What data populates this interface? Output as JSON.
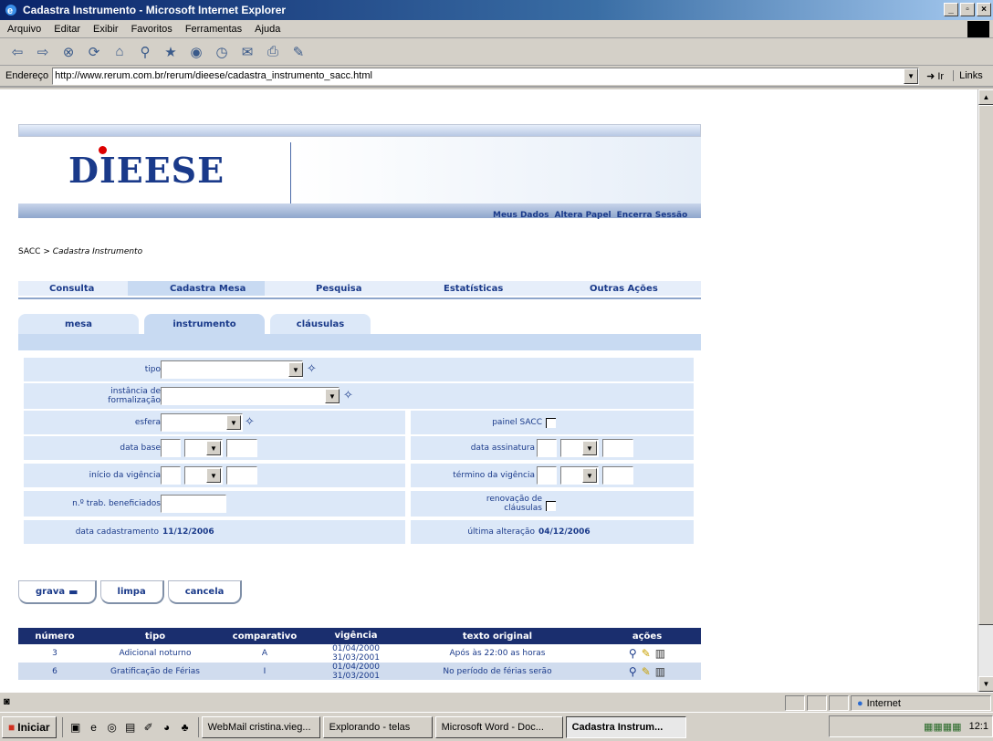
{
  "window": {
    "title": "Cadastra Instrumento - Microsoft Internet Explorer"
  },
  "menu": [
    "Arquivo",
    "Editar",
    "Exibir",
    "Favoritos",
    "Ferramentas",
    "Ajuda"
  ],
  "address": {
    "label": "Endereço",
    "url": "http://www.rerum.com.br/rerum/dieese/cadastra_instrumento_sacc.html",
    "go": "Ir",
    "links": "Links"
  },
  "header": {
    "logo": "DIEESE",
    "links": [
      "Meus Dados",
      "Altera Papel",
      "Encerra Sessão"
    ]
  },
  "breadcrumb": {
    "root": "SACC",
    "sep": ">",
    "current": "Cadastra Instrumento"
  },
  "mainnav": [
    "Consulta",
    "Cadastra Mesa",
    "Pesquisa",
    "Estatísticas",
    "Outras Ações"
  ],
  "subtabs": [
    "mesa",
    "instrumento",
    "cláusulas"
  ],
  "form": {
    "tipo": "tipo",
    "instancia": "instância de formalização",
    "esfera": "esfera",
    "painel": "painel SACC",
    "data_base": "data base",
    "data_assinatura": "data assinatura",
    "inicio_vigencia": "início da vigência",
    "termino_vigencia": "término da vigência",
    "trab": "n.º trab. beneficiados",
    "renovacao": "renovação de cláusulas",
    "data_cad_label": "data cadastramento",
    "data_cad_value": "11/12/2006",
    "ult_alt_label": "última alteração",
    "ult_alt_value": "04/12/2006"
  },
  "buttons": {
    "grava": "grava",
    "limpa": "limpa",
    "cancela": "cancela"
  },
  "table": {
    "headers": [
      "número",
      "tipo",
      "comparativo",
      "vigência",
      "texto original",
      "ações"
    ],
    "rows": [
      {
        "numero": "3",
        "tipo": "Adicional noturno",
        "comparativo": "A",
        "vig_ini": "01/04/2000",
        "vig_fim": "31/03/2001",
        "texto": "Após às 22:00 as horas"
      },
      {
        "numero": "6",
        "tipo": "Gratificação de Férias",
        "comparativo": "I",
        "vig_ini": "01/04/2000",
        "vig_fim": "31/03/2001",
        "texto": "No período de férias serão"
      }
    ]
  },
  "status": {
    "zone": "Internet"
  },
  "taskbar": {
    "start": "Iniciar",
    "tasks": [
      "WebMail cristina.vieg...",
      "Explorando - telas",
      "Microsoft Word - Doc...",
      "Cadastra Instrum..."
    ],
    "clock": "12:1"
  }
}
